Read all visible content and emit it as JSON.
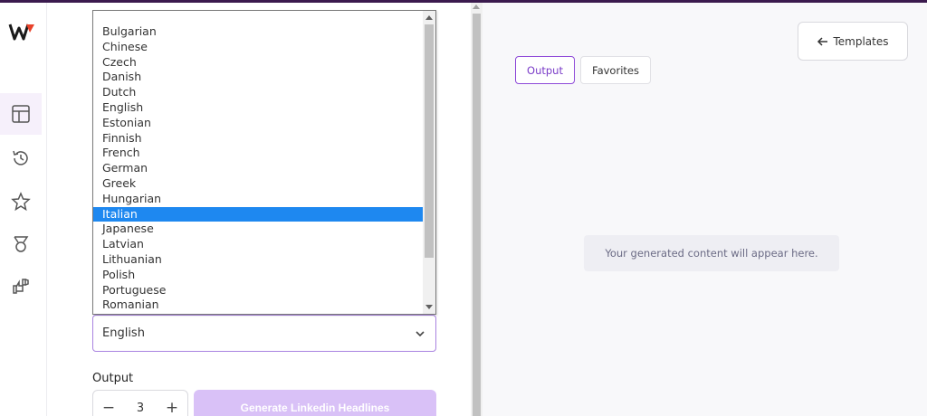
{
  "brand": {
    "accent": "#7a3cc8",
    "topbar_color": "#3b1a4e",
    "logo_colors": [
      "#1a1a1a",
      "#e8422a"
    ]
  },
  "rail": {
    "items": [
      {
        "name": "templates-layout-icon",
        "active": true
      },
      {
        "name": "history-icon",
        "active": false
      },
      {
        "name": "star-icon",
        "active": false
      },
      {
        "name": "award-icon",
        "active": false
      },
      {
        "name": "feedback-icon",
        "active": false
      }
    ]
  },
  "form": {
    "language_dropdown": {
      "options": [
        "Bulgarian",
        "Chinese",
        "Czech",
        "Danish",
        "Dutch",
        "English",
        "Estonian",
        "Finnish",
        "French",
        "German",
        "Greek",
        "Hungarian",
        "Italian",
        "Japanese",
        "Latvian",
        "Lithuanian",
        "Polish",
        "Portuguese",
        "Romanian"
      ],
      "highlighted": "Italian"
    },
    "language_select": {
      "value": "English"
    },
    "output_label": "Output",
    "stepper": {
      "minus": "−",
      "value": "3",
      "plus": "+"
    },
    "generate_label": "Generate Linkedin Headlines"
  },
  "output_pane": {
    "templates_label": "Templates",
    "tabs": [
      {
        "label": "Output",
        "active": true
      },
      {
        "label": "Favorites",
        "active": false
      }
    ],
    "placeholder": "Your generated content will appear here."
  }
}
